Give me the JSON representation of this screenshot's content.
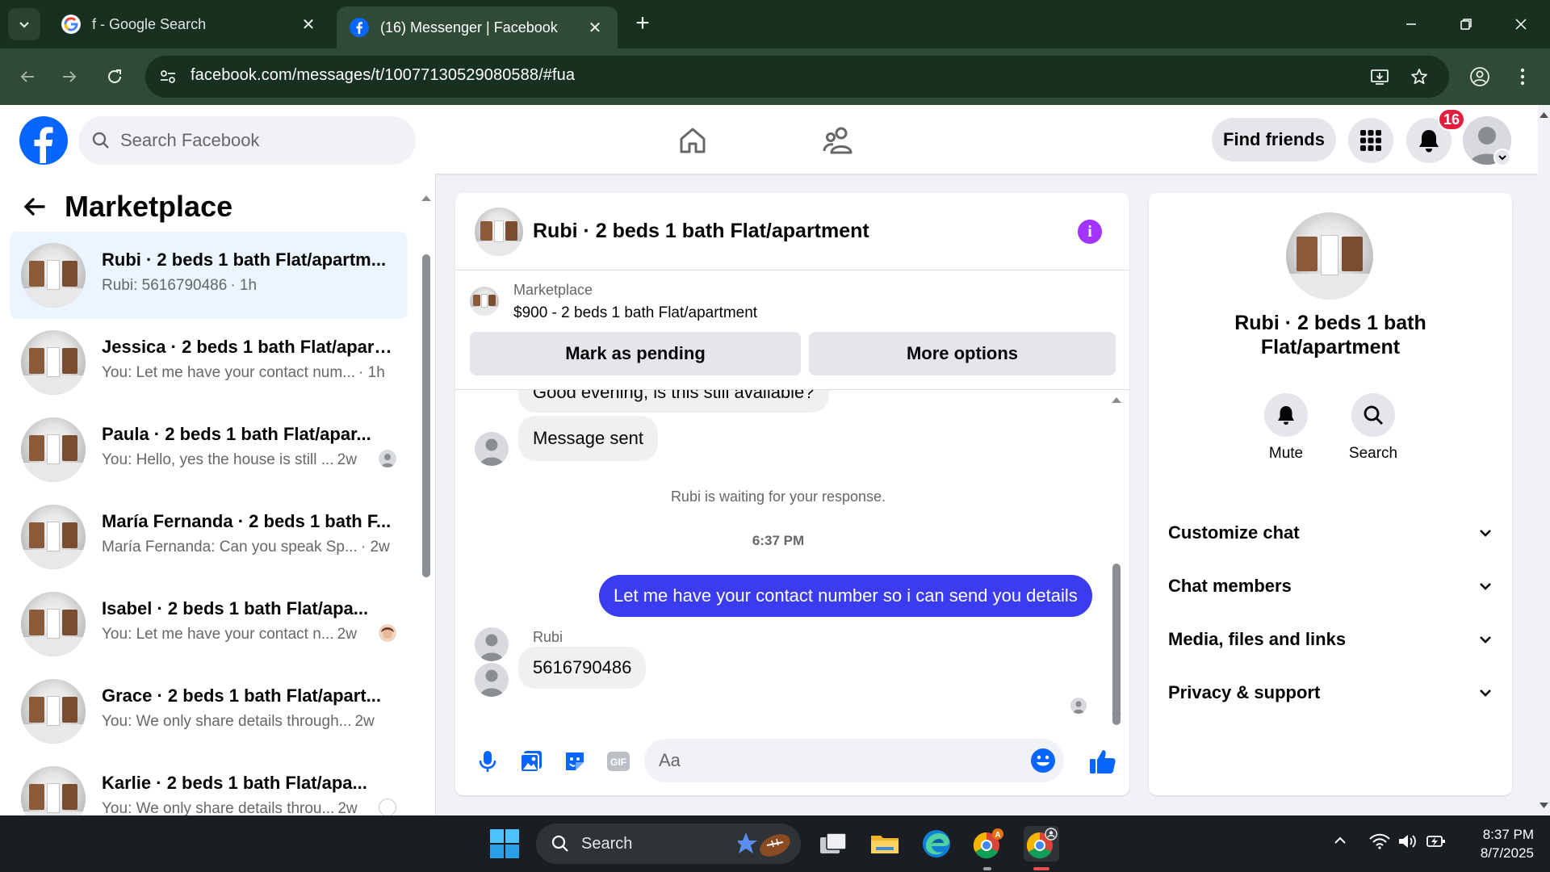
{
  "browser": {
    "tabs": [
      {
        "title": "f - Google Search",
        "active": false
      },
      {
        "title": "(16) Messenger | Facebook",
        "active": true
      }
    ],
    "new_tab_symbol": "+",
    "url": "facebook.com/messages/t/10077130529080588/#fua"
  },
  "fb_header": {
    "search_placeholder": "Search Facebook",
    "find_friends": "Find friends",
    "notification_count": "16"
  },
  "left_panel": {
    "title": "Marketplace",
    "conversations": [
      {
        "name": "Rubi · 2 beds 1 bath Flat/apartm...",
        "snippet": "Rubi: 5616790486",
        "time": "· 1h",
        "selected": true
      },
      {
        "name": "Jessica · 2 beds 1 bath Flat/apart...",
        "snippet": "You: Let me have your contact num...",
        "time": "· 1h",
        "selected": false
      },
      {
        "name": "Paula · 2 beds 1 bath Flat/apar...",
        "snippet": "You: Hello, yes the house is still ...",
        "time": "2w",
        "selected": false
      },
      {
        "name": "María Fernanda · 2 beds 1 bath F...",
        "snippet": "María Fernanda: Can you speak Sp...",
        "time": "· 2w",
        "selected": false
      },
      {
        "name": "Isabel · 2 beds 1 bath Flat/apa...",
        "snippet": "You: Let me have your contact n...",
        "time": "2w",
        "selected": false
      },
      {
        "name": "Grace · 2 beds 1 bath Flat/apart...",
        "snippet": "You: We only share details through...",
        "time": "2w",
        "selected": false
      },
      {
        "name": "Karlie · 2 beds 1 bath Flat/apa...",
        "snippet": "You: We only share details throu...",
        "time": "2w",
        "selected": false
      }
    ]
  },
  "chat": {
    "title": "Rubi · 2 beds 1 bath Flat/apartment",
    "listing": {
      "source": "Marketplace",
      "item": "$900 - 2 beds 1 bath Flat/apartment",
      "btn_pending": "Mark as pending",
      "btn_more": "More options"
    },
    "messages": {
      "partial_in": "Good evening, is this still available?",
      "sent_notice": "Message sent",
      "waiting": "Rubi is waiting for your response.",
      "timestamp": "6:37 PM",
      "outgoing": "Let me have your contact number so i can send you details",
      "sender": "Rubi",
      "reply": "5616790486"
    },
    "composer_placeholder": "Aa"
  },
  "right_panel": {
    "name_line1": "Rubi · 2 beds 1 bath",
    "name_line2": "Flat/apartment",
    "mute": "Mute",
    "search": "Search",
    "sections": [
      "Customize chat",
      "Chat members",
      "Media, files and links",
      "Privacy & support"
    ]
  },
  "taskbar": {
    "search": "Search",
    "time": "8:37 PM",
    "date": "8/7/2025"
  },
  "colors": {
    "fb_blue": "#0866ff",
    "outgoing_bubble": "#3b3bf0",
    "info_purple": "#a333ff",
    "badge_red": "#e41e3f",
    "selected_row": "#ebf5ff"
  }
}
